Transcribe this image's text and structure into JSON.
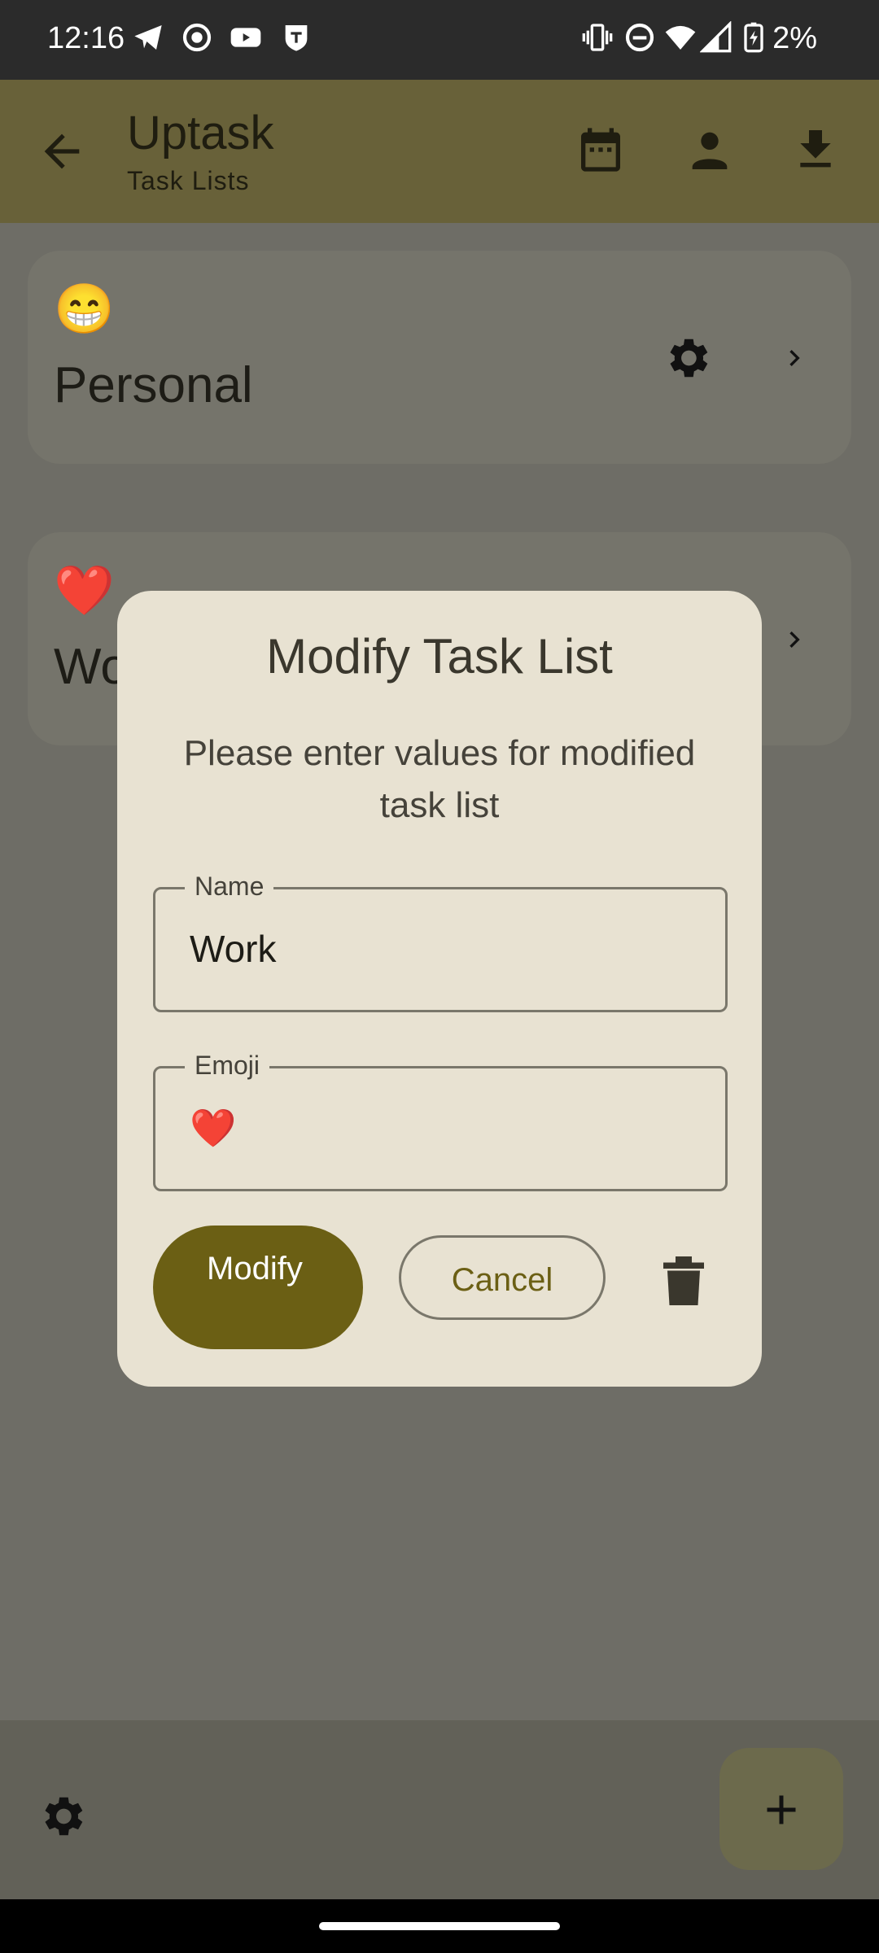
{
  "status_bar": {
    "time": "12:16",
    "battery": "2%",
    "icons": [
      "telegram-icon",
      "record-icon",
      "youtube-icon",
      "shield-icon",
      "vibrate-icon",
      "dnd-icon",
      "wifi-icon",
      "signal-icon",
      "battery-charging-icon"
    ]
  },
  "app_bar": {
    "title": "Uptask",
    "subtitle": "Task Lists",
    "icons": [
      "back-arrow-icon",
      "calendar-icon",
      "person-icon",
      "download-icon"
    ]
  },
  "task_lists": [
    {
      "emoji": "😁",
      "name": "Personal"
    },
    {
      "emoji": "❤️",
      "name": "Work"
    }
  ],
  "dialog": {
    "title": "Modify Task List",
    "text": "Please enter values for modified task list",
    "name_label": "Name",
    "name_value": "Work",
    "emoji_label": "Emoji",
    "emoji_value": "❤️",
    "modify_label": "Modify",
    "cancel_label": "Cancel"
  },
  "colors": {
    "app_bar": "#686139",
    "primary": "#6b5f14",
    "dialog_bg": "#e8e2d2"
  }
}
